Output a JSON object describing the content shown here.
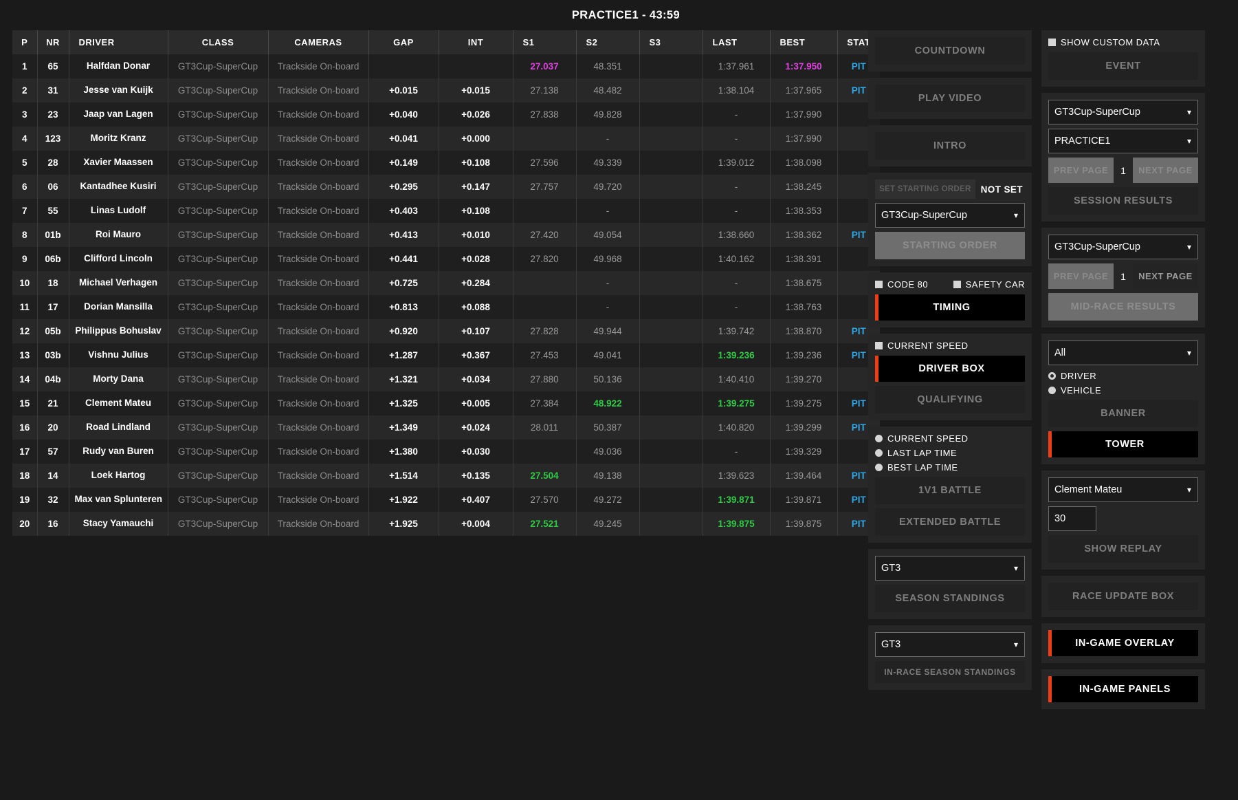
{
  "header": {
    "title": "PRACTICE1 - 43:59"
  },
  "table": {
    "columns": [
      "P",
      "NR",
      "DRIVER",
      "CLASS",
      "CAMERAS",
      "GAP",
      "INT",
      "S1",
      "S2",
      "S3",
      "LAST",
      "BEST",
      "STAT"
    ],
    "rows": [
      {
        "p": "1",
        "nr": "65",
        "driver": "Halfdan Donar",
        "cls": "GT3Cup-SuperCup",
        "cam": "Trackside On-board",
        "gap": "",
        "int": "",
        "s1": "27.037",
        "s1c": "purple",
        "s2": "48.351",
        "s2c": "",
        "s3": "",
        "s3c": "",
        "last": "1:37.961",
        "lastc": "",
        "best": "1:37.950",
        "bestc": "purple",
        "stat": "PIT"
      },
      {
        "p": "2",
        "nr": "31",
        "driver": "Jesse van Kuijk",
        "cls": "GT3Cup-SuperCup",
        "cam": "Trackside On-board",
        "gap": "+0.015",
        "int": "+0.015",
        "s1": "27.138",
        "s1c": "",
        "s2": "48.482",
        "s2c": "",
        "s3": "",
        "s3c": "",
        "last": "1:38.104",
        "lastc": "",
        "best": "1:37.965",
        "bestc": "",
        "stat": "PIT"
      },
      {
        "p": "3",
        "nr": "23",
        "driver": "Jaap van Lagen",
        "cls": "GT3Cup-SuperCup",
        "cam": "Trackside On-board",
        "gap": "+0.040",
        "int": "+0.026",
        "s1": "27.838",
        "s1c": "",
        "s2": "49.828",
        "s2c": "",
        "s3": "",
        "s3c": "",
        "last": "-",
        "lastc": "",
        "best": "1:37.990",
        "bestc": "",
        "stat": ""
      },
      {
        "p": "4",
        "nr": "123",
        "driver": "Moritz Kranz",
        "cls": "GT3Cup-SuperCup",
        "cam": "Trackside On-board",
        "gap": "+0.041",
        "int": "+0.000",
        "s1": "",
        "s1c": "",
        "s2": "-",
        "s2c": "",
        "s3": "",
        "s3c": "",
        "last": "-",
        "lastc": "",
        "best": "1:37.990",
        "bestc": "",
        "stat": ""
      },
      {
        "p": "5",
        "nr": "28",
        "driver": "Xavier Maassen",
        "cls": "GT3Cup-SuperCup",
        "cam": "Trackside On-board",
        "gap": "+0.149",
        "int": "+0.108",
        "s1": "27.596",
        "s1c": "",
        "s2": "49.339",
        "s2c": "",
        "s3": "",
        "s3c": "",
        "last": "1:39.012",
        "lastc": "",
        "best": "1:38.098",
        "bestc": "",
        "stat": ""
      },
      {
        "p": "6",
        "nr": "06",
        "driver": "Kantadhee Kusiri",
        "cls": "GT3Cup-SuperCup",
        "cam": "Trackside On-board",
        "gap": "+0.295",
        "int": "+0.147",
        "s1": "27.757",
        "s1c": "",
        "s2": "49.720",
        "s2c": "",
        "s3": "",
        "s3c": "",
        "last": "-",
        "lastc": "",
        "best": "1:38.245",
        "bestc": "",
        "stat": ""
      },
      {
        "p": "7",
        "nr": "55",
        "driver": "Linas Ludolf",
        "cls": "GT3Cup-SuperCup",
        "cam": "Trackside On-board",
        "gap": "+0.403",
        "int": "+0.108",
        "s1": "",
        "s1c": "",
        "s2": "-",
        "s2c": "",
        "s3": "",
        "s3c": "",
        "last": "-",
        "lastc": "",
        "best": "1:38.353",
        "bestc": "",
        "stat": ""
      },
      {
        "p": "8",
        "nr": "01b",
        "driver": "Roi Mauro",
        "cls": "GT3Cup-SuperCup",
        "cam": "Trackside On-board",
        "gap": "+0.413",
        "int": "+0.010",
        "s1": "27.420",
        "s1c": "",
        "s2": "49.054",
        "s2c": "",
        "s3": "",
        "s3c": "",
        "last": "1:38.660",
        "lastc": "",
        "best": "1:38.362",
        "bestc": "",
        "stat": "PIT"
      },
      {
        "p": "9",
        "nr": "06b",
        "driver": "Clifford Lincoln",
        "cls": "GT3Cup-SuperCup",
        "cam": "Trackside On-board",
        "gap": "+0.441",
        "int": "+0.028",
        "s1": "27.820",
        "s1c": "",
        "s2": "49.968",
        "s2c": "",
        "s3": "",
        "s3c": "",
        "last": "1:40.162",
        "lastc": "",
        "best": "1:38.391",
        "bestc": "",
        "stat": ""
      },
      {
        "p": "10",
        "nr": "18",
        "driver": "Michael Verhagen",
        "cls": "GT3Cup-SuperCup",
        "cam": "Trackside On-board",
        "gap": "+0.725",
        "int": "+0.284",
        "s1": "",
        "s1c": "",
        "s2": "-",
        "s2c": "",
        "s3": "",
        "s3c": "",
        "last": "-",
        "lastc": "",
        "best": "1:38.675",
        "bestc": "",
        "stat": ""
      },
      {
        "p": "11",
        "nr": "17",
        "driver": "Dorian Mansilla",
        "cls": "GT3Cup-SuperCup",
        "cam": "Trackside On-board",
        "gap": "+0.813",
        "int": "+0.088",
        "s1": "",
        "s1c": "",
        "s2": "-",
        "s2c": "",
        "s3": "",
        "s3c": "",
        "last": "-",
        "lastc": "",
        "best": "1:38.763",
        "bestc": "",
        "stat": ""
      },
      {
        "p": "12",
        "nr": "05b",
        "driver": "Philippus Bohuslav",
        "cls": "GT3Cup-SuperCup",
        "cam": "Trackside On-board",
        "gap": "+0.920",
        "int": "+0.107",
        "s1": "27.828",
        "s1c": "",
        "s2": "49.944",
        "s2c": "",
        "s3": "",
        "s3c": "",
        "last": "1:39.742",
        "lastc": "",
        "best": "1:38.870",
        "bestc": "",
        "stat": "PIT"
      },
      {
        "p": "13",
        "nr": "03b",
        "driver": "Vishnu Julius",
        "cls": "GT3Cup-SuperCup",
        "cam": "Trackside On-board",
        "gap": "+1.287",
        "int": "+0.367",
        "s1": "27.453",
        "s1c": "",
        "s2": "49.041",
        "s2c": "",
        "s3": "",
        "s3c": "",
        "last": "1:39.236",
        "lastc": "green",
        "best": "1:39.236",
        "bestc": "",
        "stat": "PIT"
      },
      {
        "p": "14",
        "nr": "04b",
        "driver": "Morty Dana",
        "cls": "GT3Cup-SuperCup",
        "cam": "Trackside On-board",
        "gap": "+1.321",
        "int": "+0.034",
        "s1": "27.880",
        "s1c": "",
        "s2": "50.136",
        "s2c": "",
        "s3": "",
        "s3c": "",
        "last": "1:40.410",
        "lastc": "",
        "best": "1:39.270",
        "bestc": "",
        "stat": ""
      },
      {
        "p": "15",
        "nr": "21",
        "driver": "Clement Mateu",
        "cls": "GT3Cup-SuperCup",
        "cam": "Trackside On-board",
        "gap": "+1.325",
        "int": "+0.005",
        "s1": "27.384",
        "s1c": "",
        "s2": "48.922",
        "s2c": "green",
        "s3": "",
        "s3c": "",
        "last": "1:39.275",
        "lastc": "green",
        "best": "1:39.275",
        "bestc": "",
        "stat": "PIT"
      },
      {
        "p": "16",
        "nr": "20",
        "driver": "Road Lindland",
        "cls": "GT3Cup-SuperCup",
        "cam": "Trackside On-board",
        "gap": "+1.349",
        "int": "+0.024",
        "s1": "28.011",
        "s1c": "",
        "s2": "50.387",
        "s2c": "",
        "s3": "",
        "s3c": "",
        "last": "1:40.820",
        "lastc": "",
        "best": "1:39.299",
        "bestc": "",
        "stat": "PIT"
      },
      {
        "p": "17",
        "nr": "57",
        "driver": "Rudy van Buren",
        "cls": "GT3Cup-SuperCup",
        "cam": "Trackside On-board",
        "gap": "+1.380",
        "int": "+0.030",
        "s1": "",
        "s1c": "",
        "s2": "49.036",
        "s2c": "",
        "s3": "",
        "s3c": "",
        "last": "-",
        "lastc": "",
        "best": "1:39.329",
        "bestc": "",
        "stat": ""
      },
      {
        "p": "18",
        "nr": "14",
        "driver": "Loek Hartog",
        "cls": "GT3Cup-SuperCup",
        "cam": "Trackside On-board",
        "gap": "+1.514",
        "int": "+0.135",
        "s1": "27.504",
        "s1c": "green",
        "s2": "49.138",
        "s2c": "",
        "s3": "",
        "s3c": "",
        "last": "1:39.623",
        "lastc": "",
        "best": "1:39.464",
        "bestc": "",
        "stat": "PIT"
      },
      {
        "p": "19",
        "nr": "32",
        "driver": "Max van Splunteren",
        "cls": "GT3Cup-SuperCup",
        "cam": "Trackside On-board",
        "gap": "+1.922",
        "int": "+0.407",
        "s1": "27.570",
        "s1c": "",
        "s2": "49.272",
        "s2c": "",
        "s3": "",
        "s3c": "",
        "last": "1:39.871",
        "lastc": "green",
        "best": "1:39.871",
        "bestc": "",
        "stat": "PIT"
      },
      {
        "p": "20",
        "nr": "16",
        "driver": "Stacy Yamauchi",
        "cls": "GT3Cup-SuperCup",
        "cam": "Trackside On-board",
        "gap": "+1.925",
        "int": "+0.004",
        "s1": "27.521",
        "s1c": "green",
        "s2": "49.245",
        "s2c": "",
        "s3": "",
        "s3c": "",
        "last": "1:39.875",
        "lastc": "green",
        "best": "1:39.875",
        "bestc": "",
        "stat": "PIT"
      }
    ]
  },
  "mid_panel": {
    "countdown_label": "COUNTDOWN",
    "play_video_label": "PLAY VIDEO",
    "intro_label": "INTRO",
    "set_starting_order_label": "SET STARTING ORDER",
    "starting_order_status": "NOT SET",
    "starting_order_class": "GT3Cup-SuperCup",
    "starting_order_label": "STARTING ORDER",
    "code80_label": "CODE 80",
    "safety_car_label": "SAFETY CAR",
    "timing_label": "TIMING",
    "current_speed_label": "CURRENT SPEED",
    "driver_box_label": "DRIVER BOX",
    "qualifying_label": "QUALIFYING",
    "battle_modes": [
      "CURRENT SPEED",
      "LAST LAP TIME",
      "BEST LAP TIME"
    ],
    "battle_1v1_label": "1V1 BATTLE",
    "extended_battle_label": "EXTENDED BATTLE",
    "season_standings_class": "GT3",
    "season_standings_label": "SEASON STANDINGS",
    "inrace_standings_class": "GT3",
    "inrace_standings_label": "IN-RACE SEASON STANDINGS"
  },
  "right_panel": {
    "show_custom_data_label": "SHOW CUSTOM DATA",
    "event_label": "EVENT",
    "results_class": "GT3Cup-SuperCup",
    "results_session": "PRACTICE1",
    "prev_page_label": "PREV PAGE",
    "next_page_label": "NEXT PAGE",
    "results_page": "1",
    "session_results_label": "SESSION RESULTS",
    "midrace_class": "GT3Cup-SuperCup",
    "midrace_prev_label": "PREV PAGE",
    "midrace_next_label": "NEXT PAGE",
    "midrace_page": "1",
    "midrace_results_label": "MID-RACE RESULTS",
    "tower_filter": "All",
    "driver_radio_label": "DRIVER",
    "vehicle_radio_label": "VEHICLE",
    "banner_label": "BANNER",
    "tower_label": "TOWER",
    "replay_driver": "Clement Mateu",
    "replay_seconds": "30",
    "show_replay_label": "SHOW REPLAY",
    "race_update_box_label": "RACE UPDATE BOX",
    "in_game_overlay_label": "IN-GAME OVERLAY",
    "in_game_panels_label": "IN-GAME PANELS"
  },
  "colors": {
    "accent_red": "#f03c14",
    "purple": "#e040e0",
    "green": "#2ecc45",
    "pit_blue": "#2fa8e8"
  }
}
